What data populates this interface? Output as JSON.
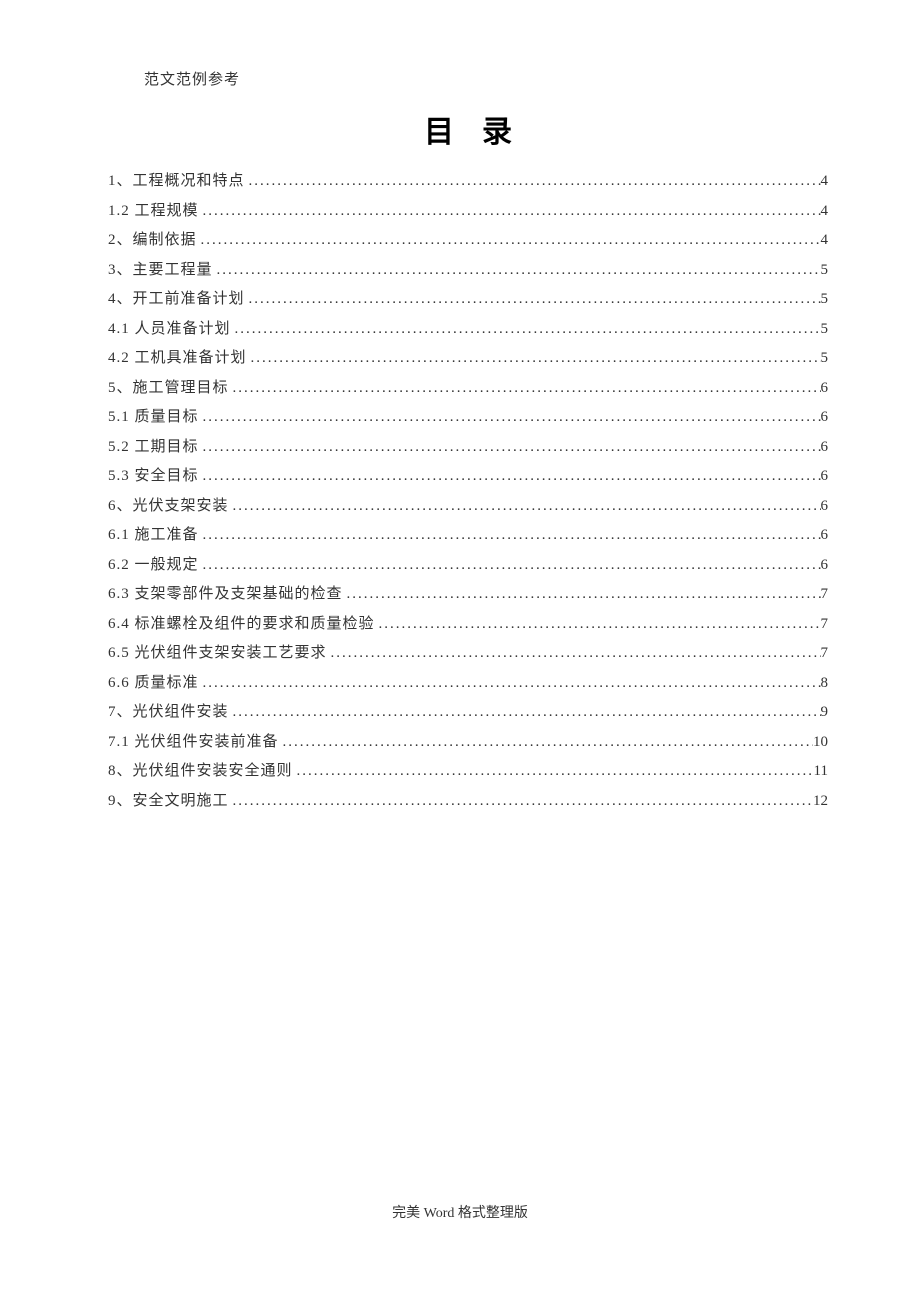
{
  "header": "范文范例参考",
  "title": "目录",
  "toc": [
    {
      "label": "1、工程概况和特点 ",
      "page": "4"
    },
    {
      "label": "1.2 工程规模 ",
      "page": "4"
    },
    {
      "label": "2、编制依据 ",
      "page": "4"
    },
    {
      "label": "3、主要工程量 ",
      "page": "5"
    },
    {
      "label": "4、开工前准备计划 ",
      "page": "5"
    },
    {
      "label": "4.1 人员准备计划 ",
      "page": "5"
    },
    {
      "label": "4.2 工机具准备计划 ",
      "page": "5"
    },
    {
      "label": "5、施工管理目标 ",
      "page": "6"
    },
    {
      "label": "5.1 质量目标 ",
      "page": "6"
    },
    {
      "label": "5.2 工期目标 ",
      "page": "6"
    },
    {
      "label": "5.3 安全目标 ",
      "page": "6"
    },
    {
      "label": "6、光伏支架安装 ",
      "page": "6"
    },
    {
      "label": "6.1 施工准备 ",
      "page": "6"
    },
    {
      "label": "6.2 一般规定 ",
      "page": "6"
    },
    {
      "label": "6.3 支架零部件及支架基础的检查 ",
      "page": "7"
    },
    {
      "label": "6.4 标准螺栓及组件的要求和质量检验 ",
      "page": "7"
    },
    {
      "label": "6.5 光伏组件支架安装工艺要求 ",
      "page": "7"
    },
    {
      "label": "6.6 质量标准 ",
      "page": "8"
    },
    {
      "label": "7、光伏组件安装 ",
      "page": "9"
    },
    {
      "label": "7.1 光伏组件安装前准备 ",
      "page": "10"
    },
    {
      "label": "8、光伏组件安装安全通则 ",
      "page": "11"
    },
    {
      "label": "9、安全文明施工 ",
      "page": "12"
    }
  ],
  "footer": {
    "prefix": "完美 ",
    "word": "Word ",
    "suffix": "格式整理版"
  }
}
